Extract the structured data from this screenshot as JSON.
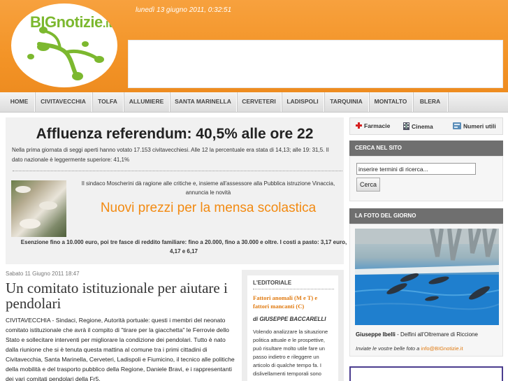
{
  "header": {
    "logo_main": "BIGnotizie",
    "logo_tld": ".it",
    "date": "lunedì 13 giugno 2011, 0:32:51"
  },
  "nav": {
    "items": [
      "HOME",
      "CIVITAVECCHIA",
      "TOLFA",
      "ALLUMIERE",
      "SANTA MARINELLA",
      "CERVETERI",
      "LADISPOLI",
      "TARQUINIA",
      "MONTALTO",
      "BLERA"
    ]
  },
  "lead": {
    "title": "Affluenza referendum: 40,5% alle ore 22",
    "text": "Nella prima giornata di seggi aperti hanno votato 17.153 civitavecchiesi. Alle 12 la percentuale era stata di 14,13; alle 19:  31,5. Il dato nazionale è leggermente superiore: 41,1%",
    "sub_intro": "Il sindaco Moscherini dà ragione alle critiche e, insieme all'assessore alla Pubblica istruzione Vinaccia, annuncia le novità",
    "sub_title": "Nuovi prezzi per la mensa scolastica",
    "sub_desc": "Esenzione fino a 10.000 euro, poi tre fasce di reddito familiare: fino a 20.000, fino a 30.000 e oltre. I costi a pasto: 3,17 euro, 4,17 e 6,17"
  },
  "article": {
    "date": "Sabato 11 Giugno 2011 18:47",
    "title": "Un comitato istituzionale per aiutare i pendolari",
    "body": "CIVITAVECCHIA - Sindaci, Regione, Autorità portuale: questi i membri del neonato comitato istituzionale che avrà il compito di \"tirare per la giacchetta\" le Ferrovie dello Stato e sollecitare interventi per migliorare la condizione dei pendolari. Tutto è nato dalla riunione che si è tenuta questa mattina al comune tra i primi cittadini di Civitavecchia, Santa Marinella, Cerveteri, Ladispoli e Fiumicino, il tecnico alle politiche della mobilità e del trasporto pubblico della Regione, Daniele Bravi, e i rappresentanti dei vari comitati pendolari della Fr5."
  },
  "editorial": {
    "heading": "L'EDITORIALE",
    "title": "Fattori anomali (M e T) e fattori mancanti (C)",
    "author": "di GIUSEPPE BACCARELLI",
    "text": "Volendo analizzare la situazione politica attuale e le prospettive, può risultare molto utile fare un passo indietro e rileggere un articolo di qualche tempo fa. I dislivellamenti temporali sono"
  },
  "utilities": {
    "pharmacies": "Farmacie",
    "cinema": "Cinema",
    "numbers": "Numeri utili"
  },
  "search": {
    "heading": "CERCA NEL SITO",
    "value": "inserire termini di ricerca...",
    "button": "Cerca"
  },
  "photo": {
    "heading": "LA FOTO DEL GIORNO",
    "author": "Giuseppe Ibelli",
    "caption": " - Delfini all'Oltremare di Riccione",
    "send_text": "Inviate le vostre belle foto a",
    "email": "info@BIGnotizie.it"
  },
  "colors": {
    "header_orange": "#f39427",
    "accent_orange": "#f28a11",
    "logo_green": "#7cb82f",
    "box_head_gray": "#6f6f6f"
  }
}
